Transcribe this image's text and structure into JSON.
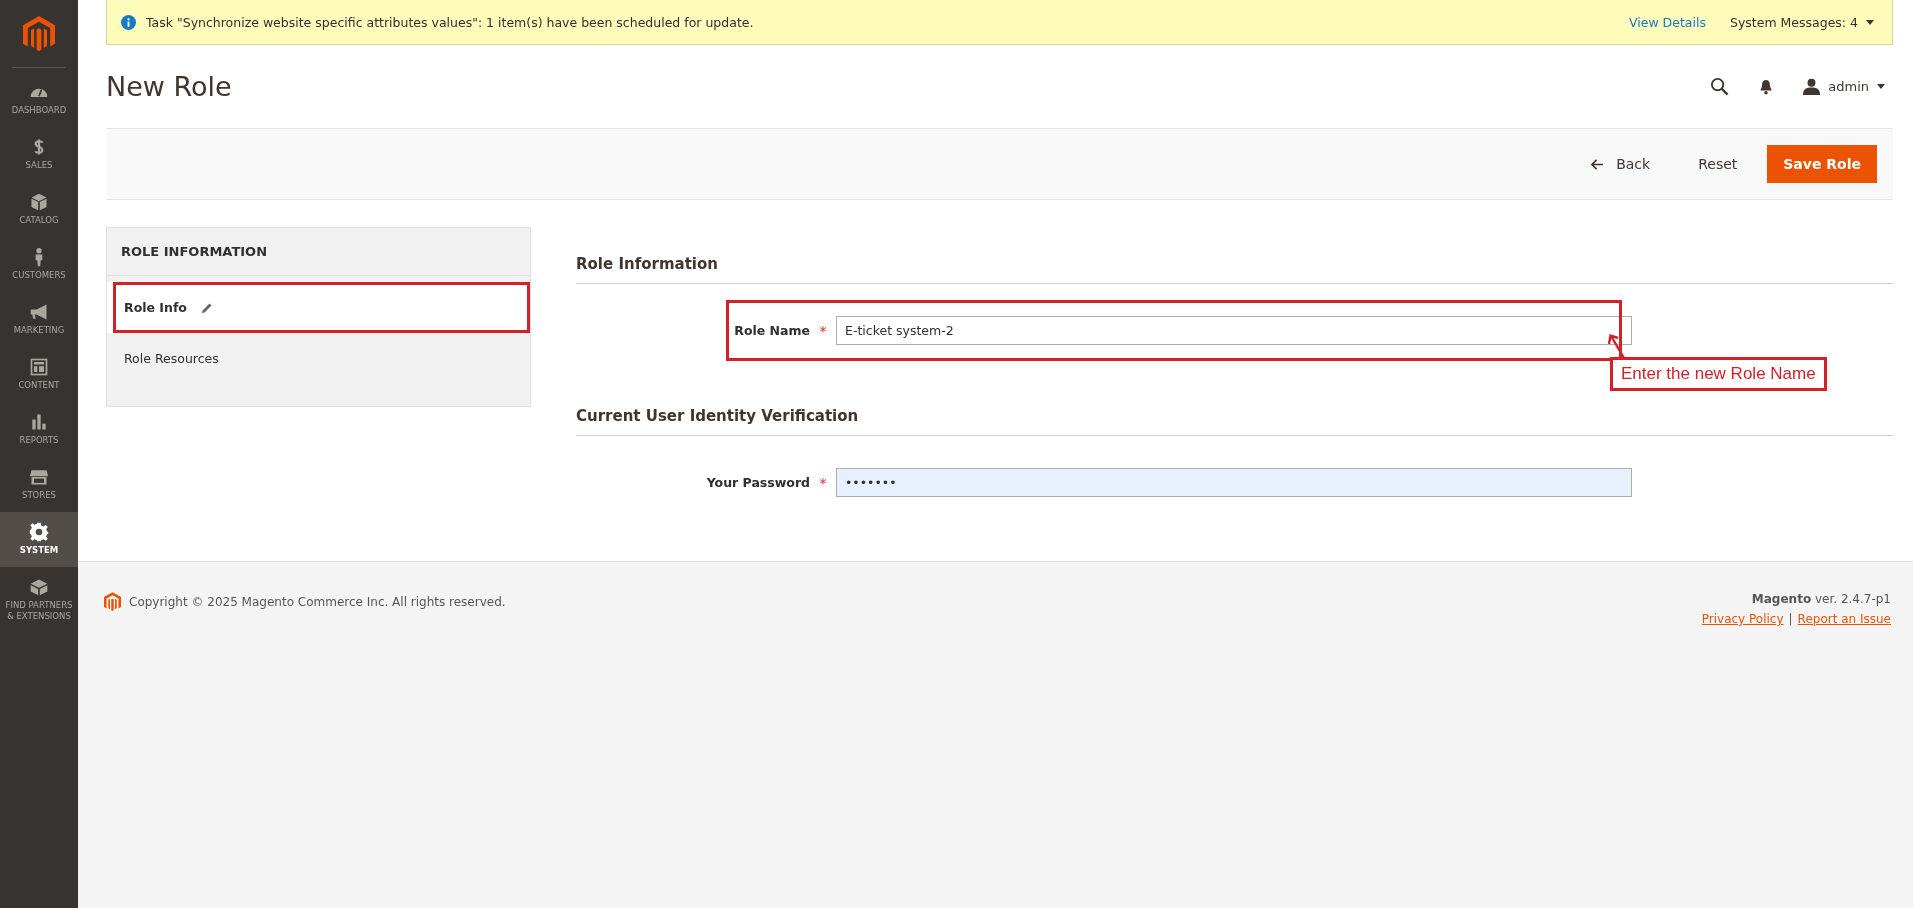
{
  "sidebar": {
    "items": [
      {
        "label": "DASHBOARD",
        "selected": false
      },
      {
        "label": "SALES",
        "selected": false
      },
      {
        "label": "CATALOG",
        "selected": false
      },
      {
        "label": "CUSTOMERS",
        "selected": false
      },
      {
        "label": "MARKETING",
        "selected": false
      },
      {
        "label": "CONTENT",
        "selected": false
      },
      {
        "label": "REPORTS",
        "selected": false
      },
      {
        "label": "STORES",
        "selected": false
      },
      {
        "label": "SYSTEM",
        "selected": true
      },
      {
        "label": "FIND PARTNERS & EXTENSIONS",
        "selected": false
      }
    ]
  },
  "notification": {
    "message": "Task \"Synchronize website specific attributes values\": 1 item(s) have been scheduled for update.",
    "link": "View Details",
    "system_messages": "System Messages: 4"
  },
  "header": {
    "title": "New Role",
    "user": "admin"
  },
  "actions": {
    "back": "Back",
    "reset": "Reset",
    "save": "Save Role"
  },
  "nav": {
    "title": "ROLE INFORMATION",
    "items": [
      {
        "label": "Role Info",
        "selected": true,
        "edited": true
      },
      {
        "label": "Role Resources",
        "selected": false,
        "edited": false
      }
    ]
  },
  "sections": [
    {
      "title": "Role Information",
      "fields": [
        {
          "label": "Role Name",
          "required_mark": "*",
          "value": "E-ticket system-2",
          "autofilled": false,
          "highlighted": true
        }
      ]
    },
    {
      "title": "Current User Identity Verification",
      "fields": [
        {
          "label": "Your Password",
          "required_mark": "*",
          "value": "•••••••",
          "autofilled": true,
          "highlighted": false
        }
      ]
    }
  ],
  "annotation": {
    "text": "Enter the new Role Name"
  },
  "footer": {
    "copyright": "Copyright © 2025 Magento Commerce Inc. All rights reserved.",
    "version": "**Magento** ver. 2.4.7-p1",
    "links": [
      "Privacy Policy",
      "Report an Issue"
    ],
    "separator": "|"
  }
}
